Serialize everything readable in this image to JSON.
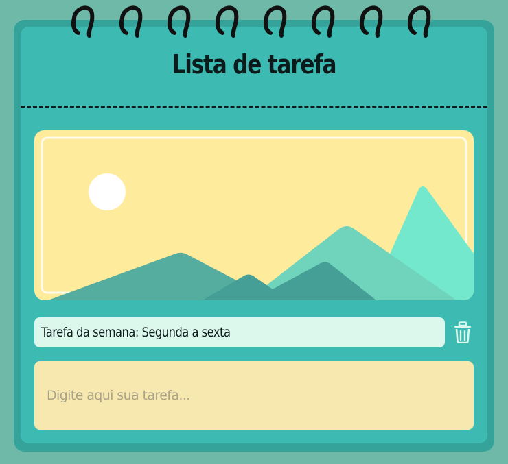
{
  "app": {
    "title": "Lista de tarefa"
  },
  "tasks": [
    {
      "text": "Tarefa da semana: Segunda a sexta",
      "delete_icon": "trash-icon"
    }
  ],
  "new_task": {
    "placeholder": "Digite aqui sua tarefa...",
    "value": ""
  },
  "colors": {
    "background": "#6fb9a8",
    "notebook": "#3dbbb3",
    "illustration_sky": "#ffeb9c",
    "task_row": "#dcf7ec",
    "input": "#f7e8af",
    "trash_icon": "#dcf7ec"
  }
}
